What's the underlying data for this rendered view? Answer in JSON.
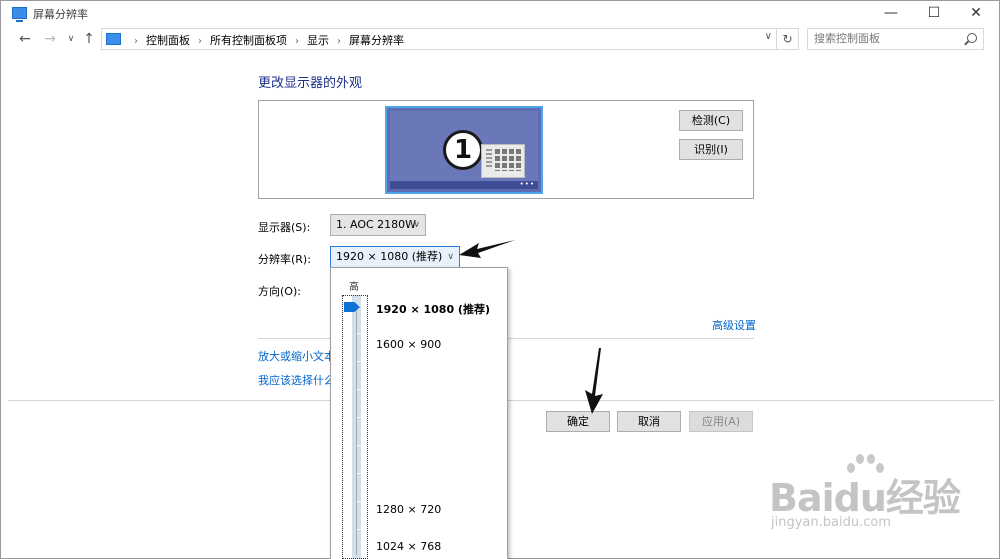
{
  "window": {
    "title": "屏幕分辨率",
    "minimize": "—",
    "maximize": "☐",
    "close": "✕"
  },
  "nav": {
    "back": "←",
    "forward": "→",
    "recent": "∨",
    "up": "↑",
    "breadcrumbs": [
      "控制面板",
      "所有控制面板项",
      "显示",
      "屏幕分辨率"
    ],
    "separator": "›",
    "address_dropdown": "∨",
    "refresh": "↻",
    "search_placeholder": "搜索控制面板"
  },
  "content": {
    "title": "更改显示器的外观",
    "monitor_number": "1",
    "monitor_dots": "•••",
    "detect_button": "检测(C)",
    "identify_button": "识别(I)",
    "display_label": "显示器(S):",
    "display_value": "1. AOC 2180W",
    "resolution_label": "分辨率(R):",
    "resolution_value": "1920 × 1080 (推荐)",
    "orientation_label": "方向(O):",
    "dropdown_arrow": "∨",
    "advanced_link": "高级设置",
    "zoom_link": "放大或缩小文本",
    "choose_link": "我应该选择什么",
    "ok_button": "确定",
    "cancel_button": "取消",
    "apply_button": "应用(A)"
  },
  "resolution_dropdown": {
    "high_label": "高",
    "slider_level": 1.0,
    "options": [
      "1920 × 1080 (推荐)",
      "1600 × 900",
      "1280 × 720",
      "1024 × 768"
    ],
    "selected_index": 0
  },
  "watermark": {
    "logo_text": "Baidu经验",
    "url": "jingyan.baidu.com"
  },
  "colors": {
    "link": "#0066cc",
    "title": "#1e3287",
    "accent": "#0f73d6",
    "monitor": "#5e6db1"
  }
}
